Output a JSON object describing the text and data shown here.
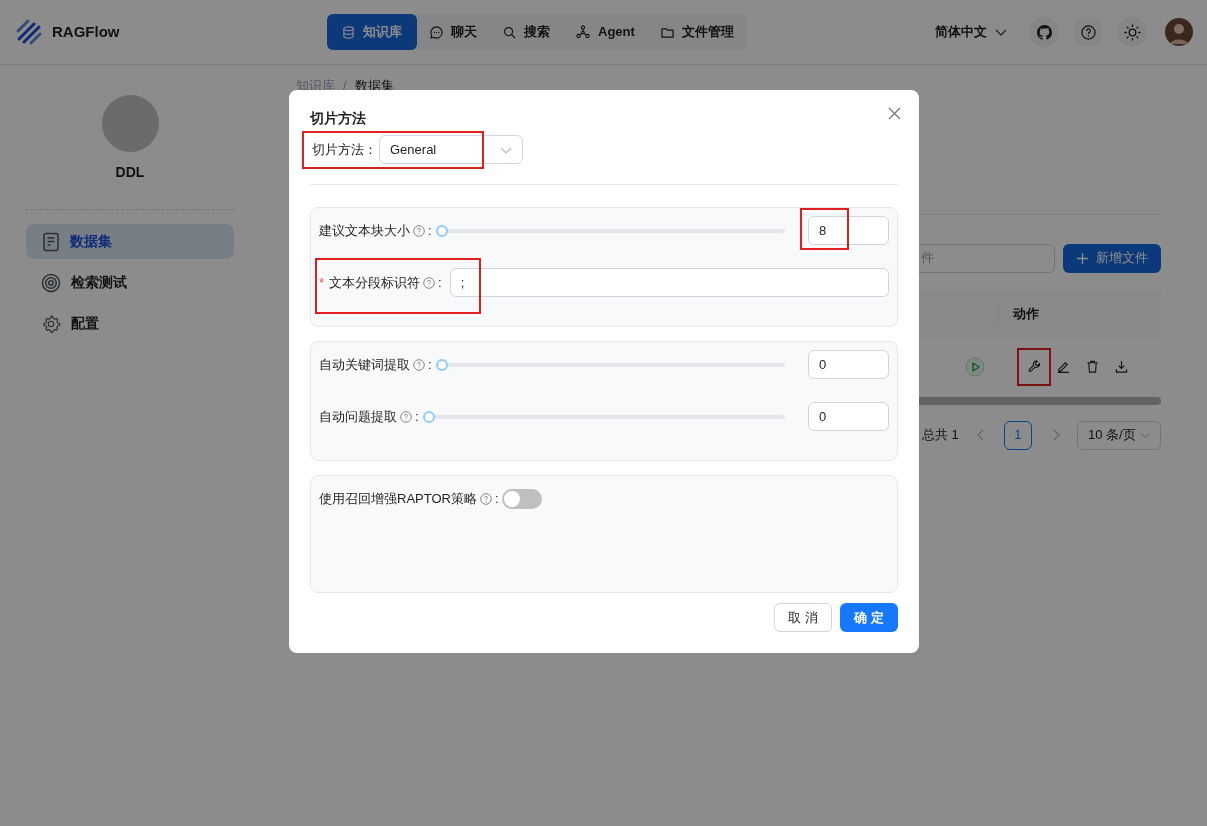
{
  "header": {
    "brand": "RAGFlow",
    "nav": [
      {
        "label": "知识库",
        "selected": true
      },
      {
        "label": "聊天",
        "selected": false
      },
      {
        "label": "搜索",
        "selected": false
      },
      {
        "label": "Agent",
        "selected": false
      },
      {
        "label": "文件管理",
        "selected": false
      }
    ],
    "language": "简体中文"
  },
  "sidebar": {
    "dataset_name": "DDL",
    "items": [
      {
        "label": "数据集",
        "selected": true
      },
      {
        "label": "检索测试",
        "selected": false
      },
      {
        "label": "配置",
        "selected": false
      }
    ]
  },
  "breadcrumb": {
    "items": [
      "知识库",
      "数据集"
    ],
    "separator": "/"
  },
  "files": {
    "search_placeholder": "件",
    "add_button": "新增文件",
    "columns": [
      "动作"
    ],
    "action_annotated": true,
    "pagination": {
      "total": "总共 1",
      "pages": [
        {
          "label": "1",
          "selected": true
        }
      ],
      "page_size": "10 条/页"
    }
  },
  "dialog": {
    "title": "切片方法",
    "method_label": "切片方法：",
    "method_value": "General",
    "method_annotated": true,
    "groups": [
      {
        "rows": [
          {
            "kind": "slider",
            "label": "建议文本块大小",
            "colon": ":",
            "level": 0,
            "value": "8",
            "annotated": true
          },
          {
            "kind": "text",
            "required_mark": "*",
            "label": "文本分段标识符",
            "colon": ":",
            "value": ";",
            "annotated": true
          }
        ]
      },
      {
        "rows": [
          {
            "kind": "slider",
            "label": "自动关键词提取",
            "colon": ":",
            "level": 0,
            "value": "0"
          },
          {
            "kind": "slider",
            "label": "自动问题提取",
            "colon": ":",
            "level": 0,
            "value": "0"
          }
        ]
      },
      {
        "rows": [
          {
            "kind": "switch",
            "label": "使用召回增强RAPTOR策略",
            "colon": ":",
            "on": false
          }
        ]
      }
    ],
    "cancel": "取 消",
    "ok": "确 定"
  }
}
